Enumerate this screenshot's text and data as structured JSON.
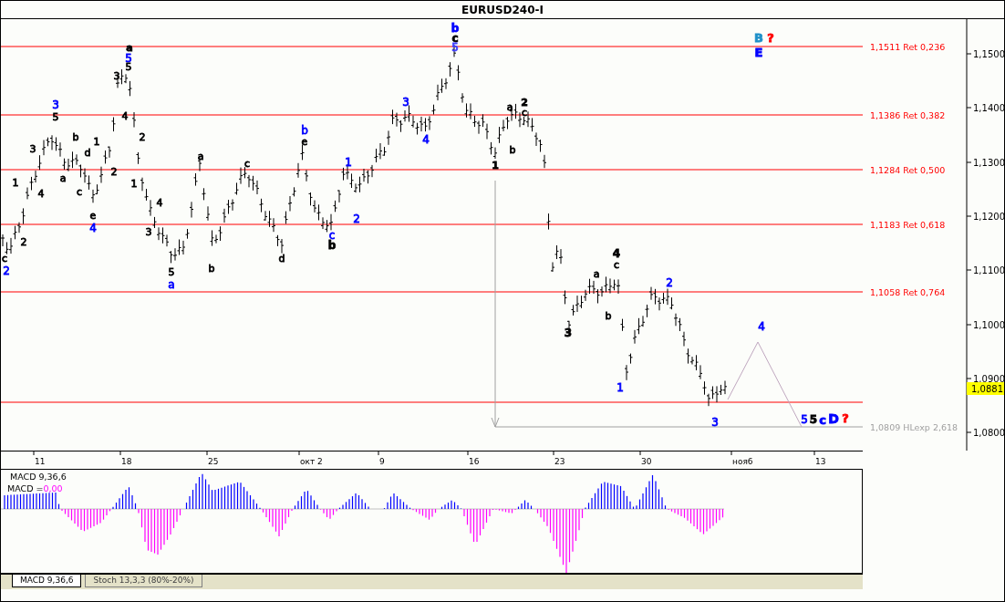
{
  "window": {
    "title": "EURUSD240-I"
  },
  "price_axis": [
    "1,1500",
    "1,1400",
    "1,1300",
    "1,1200",
    "1,1100",
    "1,1000",
    "1,0900",
    "1,0800"
  ],
  "current_price": "1,0881",
  "levels": [
    {
      "label": "1,1511 Ret 0,236",
      "kind": "retracement"
    },
    {
      "label": "1,1386 Ret 0,382",
      "kind": "retracement"
    },
    {
      "label": "1,1284 Ret 0,500",
      "kind": "retracement"
    },
    {
      "label": "1,1183 Ret 0,618",
      "kind": "retracement"
    },
    {
      "label": "1,1058 Ret 0,764",
      "kind": "retracement"
    },
    {
      "label": "1,0809 HLexp 2,618",
      "kind": "expansion"
    }
  ],
  "wave_labels": [
    {
      "text": "c",
      "color": "#000000",
      "bold": false
    },
    {
      "text": "2",
      "color": "#0000ff",
      "bold": false
    },
    {
      "text": "1",
      "color": "#000000",
      "bold": false
    },
    {
      "text": "2",
      "color": "#000000",
      "bold": false
    },
    {
      "text": "3",
      "color": "#000000",
      "bold": false
    },
    {
      "text": "4",
      "color": "#000000",
      "bold": false
    },
    {
      "text": "3",
      "color": "#0000ff",
      "bold": false
    },
    {
      "text": "5",
      "color": "#000000",
      "bold": false
    },
    {
      "text": "a",
      "color": "#000000",
      "bold": false
    },
    {
      "text": "b",
      "color": "#000000",
      "bold": false
    },
    {
      "text": "c",
      "color": "#000000",
      "bold": false
    },
    {
      "text": "d",
      "color": "#000000",
      "bold": false
    },
    {
      "text": "1",
      "color": "#000000",
      "bold": false
    },
    {
      "text": "e",
      "color": "#000000",
      "bold": false
    },
    {
      "text": "4",
      "color": "#0000ff",
      "bold": false
    },
    {
      "text": "2",
      "color": "#000000",
      "bold": false
    },
    {
      "text": "3",
      "color": "#000000",
      "bold": false
    },
    {
      "text": "4",
      "color": "#000000",
      "bold": false
    },
    {
      "text": "a",
      "color": "#000000",
      "bold": true
    },
    {
      "text": "5",
      "color": "#0000ff",
      "bold": false
    },
    {
      "text": "5",
      "color": "#000000",
      "bold": false
    },
    {
      "text": "1",
      "color": "#000000",
      "bold": false
    },
    {
      "text": "2",
      "color": "#000000",
      "bold": false
    },
    {
      "text": "4",
      "color": "#000000",
      "bold": false
    },
    {
      "text": "3",
      "color": "#000000",
      "bold": false
    },
    {
      "text": "5",
      "color": "#000000",
      "bold": false
    },
    {
      "text": "a",
      "color": "#0000ff",
      "bold": false
    },
    {
      "text": "a",
      "color": "#000000",
      "bold": false
    },
    {
      "text": "b",
      "color": "#000000",
      "bold": false
    },
    {
      "text": "c",
      "color": "#000000",
      "bold": false
    },
    {
      "text": "d",
      "color": "#000000",
      "bold": false
    },
    {
      "text": "b",
      "color": "#0000ff",
      "bold": false
    },
    {
      "text": "e",
      "color": "#000000",
      "bold": false
    },
    {
      "text": "1",
      "color": "#0000ff",
      "bold": false
    },
    {
      "text": "c",
      "color": "#0000ff",
      "bold": false
    },
    {
      "text": "b",
      "color": "#000000",
      "bold": true
    },
    {
      "text": "2",
      "color": "#0000ff",
      "bold": false
    },
    {
      "text": "3",
      "color": "#0000ff",
      "bold": false
    },
    {
      "text": "4",
      "color": "#0000ff",
      "bold": false
    },
    {
      "text": "b",
      "color": "#0000ff",
      "bold": true
    },
    {
      "text": "c",
      "color": "#000000",
      "bold": true
    },
    {
      "text": "5",
      "color": "#4040ff",
      "bold": false
    },
    {
      "text": "1",
      "color": "#000000",
      "bold": true
    },
    {
      "text": "a",
      "color": "#000000",
      "bold": false
    },
    {
      "text": "2",
      "color": "#000000",
      "bold": true
    },
    {
      "text": "c",
      "color": "#000000",
      "bold": false
    },
    {
      "text": "b",
      "color": "#000000",
      "bold": false
    },
    {
      "text": "4",
      "color": "#000000",
      "bold": true
    },
    {
      "text": "c",
      "color": "#000000",
      "bold": false
    },
    {
      "text": "a",
      "color": "#000000",
      "bold": false
    },
    {
      "text": "2",
      "color": "#0000ff",
      "bold": false
    },
    {
      "text": "B",
      "color": "#1e90c8",
      "bold": true
    },
    {
      "text": "?",
      "color": "#ff0000",
      "bold": true
    },
    {
      "text": "E",
      "color": "#0000ff",
      "bold": true
    },
    {
      "text": "b",
      "color": "#000000",
      "bold": false
    },
    {
      "text": "3",
      "color": "#000000",
      "bold": true
    },
    {
      "text": "1",
      "color": "#0000ff",
      "bold": false
    },
    {
      "text": "4",
      "color": "#0000ff",
      "bold": false
    },
    {
      "text": "3",
      "color": "#0000ff",
      "bold": false
    },
    {
      "text": "5",
      "color": "#0000ff",
      "bold": false
    },
    {
      "text": "5",
      "color": "#000000",
      "bold": true
    },
    {
      "text": "c",
      "color": "#0000ff",
      "bold": true
    },
    {
      "text": "D",
      "color": "#0000ff",
      "bold": true
    },
    {
      "text": "?",
      "color": "#ff0000",
      "bold": true
    }
  ],
  "date_axis": [
    "11",
    "18",
    "25",
    "окт 2",
    "9",
    "16",
    "23",
    "30",
    "ноя6",
    "13"
  ],
  "macd": {
    "title": "MACD 9,36,6",
    "value_label": "MACD =",
    "value": "0,00"
  },
  "tabs": [
    {
      "label": "MACD 9,36,6",
      "selected": true
    },
    {
      "label": "Stoch 13,3,3 (80%-20%)",
      "selected": false
    }
  ]
}
